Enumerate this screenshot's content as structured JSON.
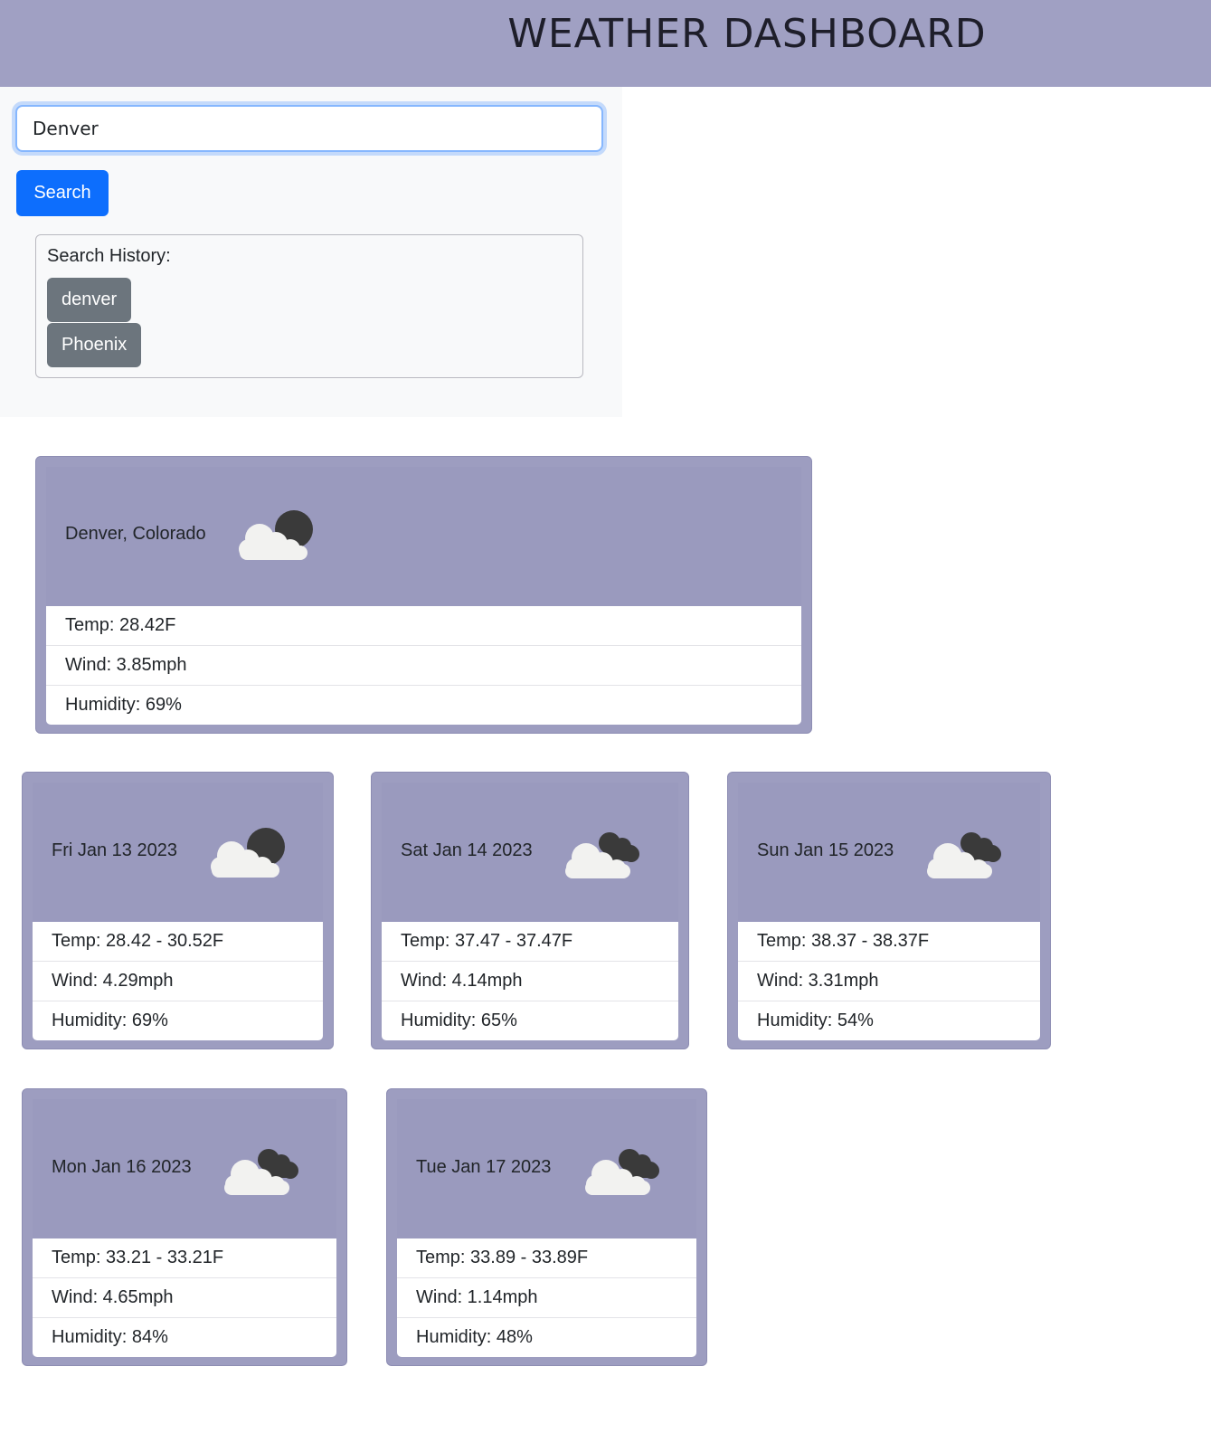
{
  "header": {
    "title": "WEATHER DASHBOARD"
  },
  "search": {
    "value": "Denver",
    "button_label": "Search"
  },
  "history": {
    "label": "Search History:",
    "items": [
      "denver",
      "Phoenix"
    ]
  },
  "current": {
    "location": "Denver, Colorado",
    "icon": "clouds-night-icon",
    "temp": "Temp: 28.42F",
    "wind": "Wind: 3.85mph",
    "humidity": "Humidity: 69%"
  },
  "forecast": [
    {
      "date": "Fri Jan 13 2023",
      "icon": "clouds-night-icon",
      "temp": "Temp: 28.42 - 30.52F",
      "wind": "Wind: 4.29mph",
      "humidity": "Humidity: 69%"
    },
    {
      "date": "Sat Jan 14 2023",
      "icon": "broken-clouds-icon",
      "temp": "Temp: 37.47 - 37.47F",
      "wind": "Wind: 4.14mph",
      "humidity": "Humidity: 65%"
    },
    {
      "date": "Sun Jan 15 2023",
      "icon": "broken-clouds-icon",
      "temp": "Temp: 38.37 - 38.37F",
      "wind": "Wind: 3.31mph",
      "humidity": "Humidity: 54%"
    },
    {
      "date": "Mon Jan 16 2023",
      "icon": "broken-clouds-icon",
      "temp": "Temp: 33.21 - 33.21F",
      "wind": "Wind: 4.65mph",
      "humidity": "Humidity: 84%"
    },
    {
      "date": "Tue Jan 17 2023",
      "icon": "broken-clouds-icon",
      "temp": "Temp: 33.89 - 33.89F",
      "wind": "Wind: 1.14mph",
      "humidity": "Humidity: 48%"
    }
  ],
  "colors": {
    "header_bg": "#a0a0c3",
    "card_bg": "#9d9dc0",
    "search_button": "#0d6efd",
    "history_button": "#6c757d"
  }
}
